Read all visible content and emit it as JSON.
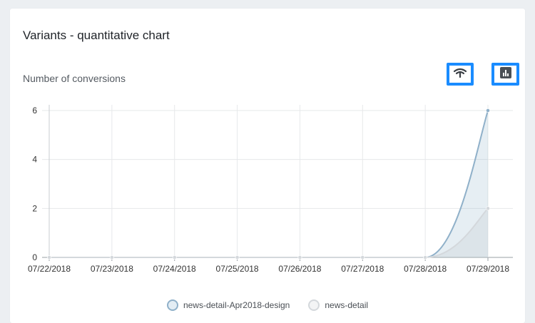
{
  "card": {
    "title": "Variants - quantitative chart",
    "subtitle": "Number of conversions"
  },
  "toolbar": {
    "area_icon": "area-chart-icon",
    "bar_icon": "bar-chart-icon",
    "highlight_color": "#1a8cff"
  },
  "chart_data": {
    "type": "area",
    "x": [
      "07/22/2018",
      "07/23/2018",
      "07/24/2018",
      "07/25/2018",
      "07/26/2018",
      "07/27/2018",
      "07/28/2018",
      "07/29/2018"
    ],
    "series": [
      {
        "name": "news-detail-Apr2018-design",
        "values": [
          0,
          0,
          0,
          0,
          0,
          0,
          0,
          6
        ],
        "color": "#8fb0c9"
      },
      {
        "name": "news-detail",
        "values": [
          0,
          0,
          0,
          0,
          0,
          0,
          0,
          2
        ],
        "color": "#d4d8dc"
      }
    ],
    "yticks": [
      "0",
      "2",
      "4",
      "6"
    ],
    "ylim": [
      0,
      6
    ],
    "grid": true,
    "legend": "bottom-center"
  }
}
